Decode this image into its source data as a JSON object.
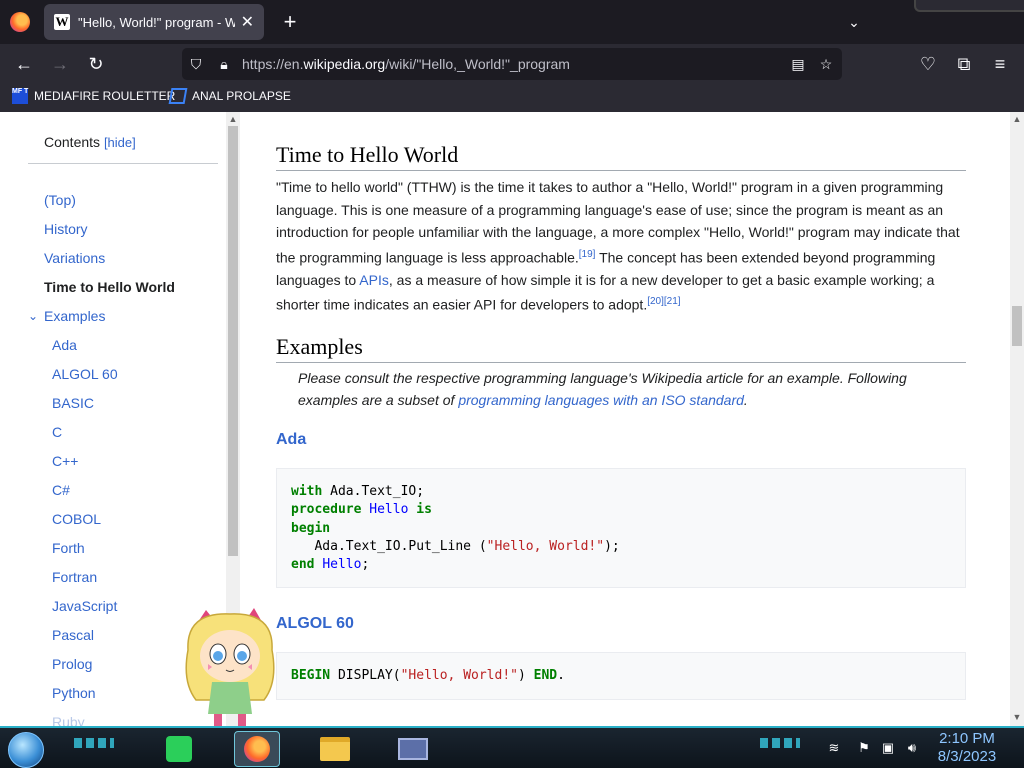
{
  "browser": {
    "tab_title": "\"Hello, World!\" program - Wiki",
    "tab_favicon": "W",
    "new_tab_label": "+",
    "url_prefix": "https://en.",
    "url_host": "wikipedia.org",
    "url_path": "/wiki/\"Hello,_World!\"_program",
    "bookmarks": [
      {
        "label": "MEDIAFIRE ROULETTER",
        "icon": "mediafire-icon",
        "icon_text": "MF T"
      },
      {
        "label": "ANAL PROLAPSE",
        "icon": "sigma-icon"
      }
    ]
  },
  "toc": {
    "title": "Contents",
    "hide_label": "[hide]",
    "items": [
      {
        "label": "(Top)"
      },
      {
        "label": "History"
      },
      {
        "label": "Variations"
      },
      {
        "label": "Time to Hello World",
        "current": true
      },
      {
        "label": "Examples",
        "expanded": true
      }
    ],
    "sub_items": [
      "Ada",
      "ALGOL 60",
      "BASIC",
      "C",
      "C++",
      "C#",
      "COBOL",
      "Forth",
      "Fortran",
      "JavaScript",
      "Pascal",
      "Prolog",
      "Python",
      "Ruby"
    ]
  },
  "article": {
    "section1_heading": "Time to Hello World",
    "section1_text_a": "\"Time to hello world\" (TTHW) is the time it takes to author a \"Hello, World!\" program in a given programming language. This is one measure of a programming language's ease of use; since the program is meant as an introduction for people unfamiliar with the language, a more complex \"Hello, World!\" program may indicate that the programming language is less approachable.",
    "ref_19": "[19]",
    "section1_text_b": " The concept has been extended beyond programming languages to ",
    "apis_link": "APIs",
    "section1_text_c": ", as a measure of how simple it is for a new developer to get a basic example working; a shorter time indicates an easier API for developers to adopt.",
    "ref_20_21": "[20][21]",
    "section2_heading": "Examples",
    "note_text": "Please consult the respective programming language's Wikipedia article for an example. Following examples are a subset of ",
    "note_link": "programming languages with an ISO standard",
    "note_end": ".",
    "ada_heading": "Ada",
    "ada_code": {
      "kw_with": "with",
      "line1_rest": " Ada.Text_IO;",
      "kw_procedure": "procedure",
      "proc_name": "Hello",
      "kw_is": "is",
      "kw_begin": "begin",
      "line4_pre": "   Ada.Text_IO.Put_Line (",
      "line4_str": "\"Hello, World!\"",
      "line4_post": ");",
      "kw_end": "end",
      "end_name": "Hello",
      "line5_post": ";"
    },
    "algol_heading": "ALGOL 60",
    "algol_code": {
      "kw_begin": "BEGIN",
      "display": " DISPLAY(",
      "str": "\"Hello, World!\"",
      "close": ") ",
      "kw_end": "END",
      "dot": "."
    }
  },
  "taskbar": {
    "time": "2:10 PM",
    "date": "8/3/2023",
    "apps": [
      "notes-app-icon",
      "firefox-icon",
      "file-explorer-icon",
      "window-app-icon"
    ]
  },
  "colors": {
    "link": "#3366cc",
    "tab_bg": "#42414d",
    "chrome_bg": "#2b2a33",
    "taskbar_accent": "#2ab0c8"
  }
}
